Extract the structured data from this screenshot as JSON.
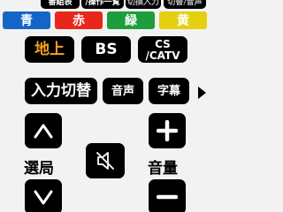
{
  "top_row": {
    "program_guide": "番組表",
    "operation_list": "/操作一覧",
    "input_switch_small": "切換入力",
    "surround": "切替/音声"
  },
  "color_keys": [
    {
      "label": "青",
      "color": "#1565c8"
    },
    {
      "label": "赤",
      "color": "#e8271b"
    },
    {
      "label": "緑",
      "color": "#1e9e3a"
    },
    {
      "label": "黄",
      "color": "#e6cf10"
    }
  ],
  "broadcast": {
    "terrestrial": "地上",
    "bs": "BS",
    "cs_line1": "CS",
    "cs_line2": "/CATV"
  },
  "functions": {
    "input_switch": "入力切替",
    "audio": "音声",
    "subtitles": "字幕"
  },
  "channel": {
    "label": "選局",
    "up_icon": "chevron-up-icon",
    "down_icon": "chevron-down-icon"
  },
  "volume": {
    "label": "音量",
    "up_icon": "plus-icon",
    "down_icon": "minus-icon"
  },
  "mute": {
    "icon": "mute-icon"
  },
  "accent_colors": {
    "key_bg": "#000000",
    "key_text": "#ffffff",
    "terrestrial_text": "#f0a21c",
    "background": "#f2f2f2"
  }
}
